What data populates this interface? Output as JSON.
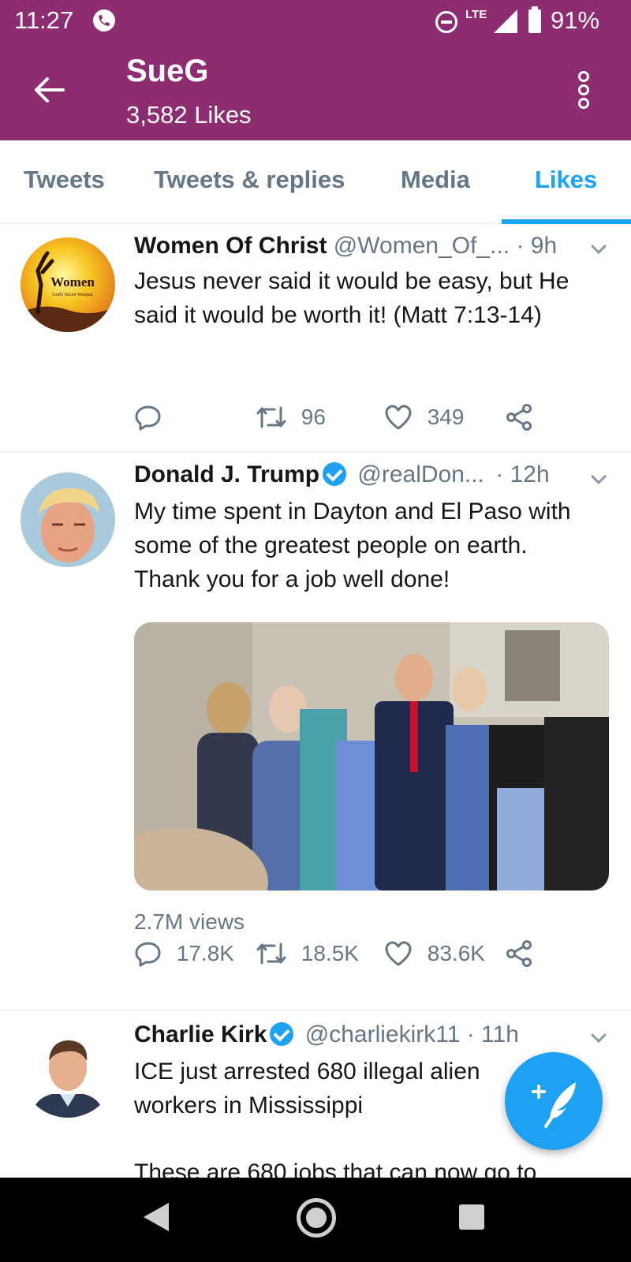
{
  "status_bar": {
    "time": "11:27",
    "network": "LTE",
    "battery": "91%"
  },
  "header": {
    "title": "SueG",
    "subtitle": "3,582 Likes"
  },
  "tabs": [
    {
      "label": "Tweets",
      "active": false
    },
    {
      "label": "Tweets & replies",
      "active": false
    },
    {
      "label": "Media",
      "active": false
    },
    {
      "label": "Likes",
      "active": true
    }
  ],
  "tweets": [
    {
      "name": "Women Of Christ",
      "handle": "@Women_Of_...",
      "time": "· 9h",
      "verified": false,
      "avatar_text": "Women",
      "avatar_subtext": "God's Secret Weapon",
      "text": "Jesus never said it would be easy, but He said it would be worth it! (Matt 7:13-14)",
      "replies": "",
      "retweets": "96",
      "likes": "349"
    },
    {
      "name": "Donald J. Trump",
      "handle": "@realDon...",
      "time": "· 12h",
      "verified": true,
      "text": "My time spent in Dayton and El Paso with some of the greatest people on earth. Thank you for a job well done!",
      "views": "2.7M views",
      "replies": "17.8K",
      "retweets": "18.5K",
      "likes": "83.6K"
    },
    {
      "name": "Charlie Kirk",
      "handle": "@charliekirk11",
      "time": "· 11h",
      "verified": true,
      "text": "ICE just arrested 680 illegal alien workers in Mississippi",
      "text2": "These are 680 jobs that can now go to"
    }
  ],
  "colors": {
    "header_bg": "#8e2c71",
    "accent": "#1da1f2",
    "muted": "#657786"
  }
}
